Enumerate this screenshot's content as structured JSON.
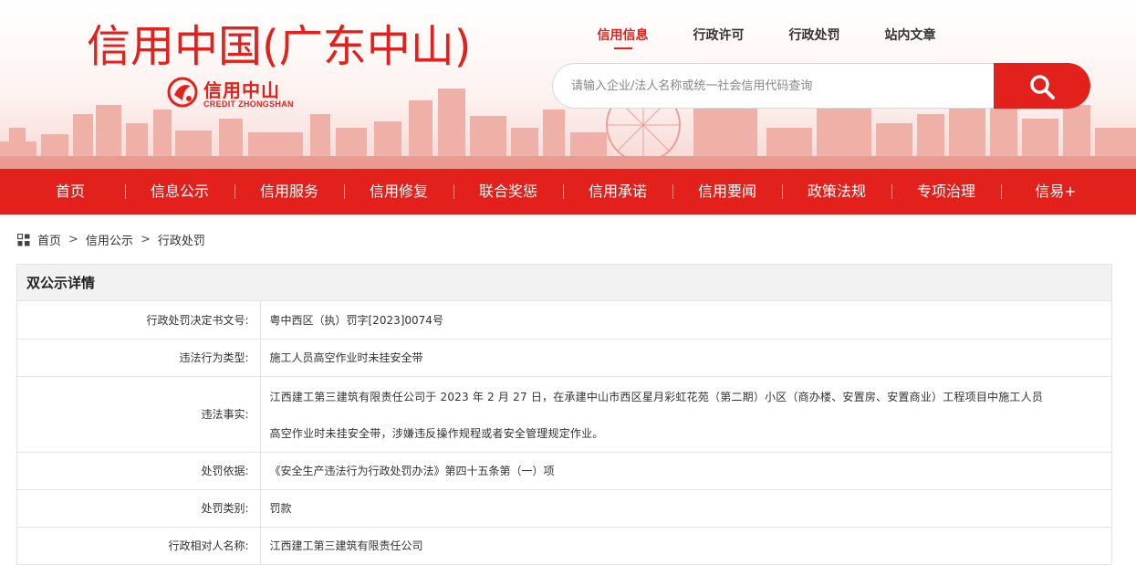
{
  "header": {
    "site_title": "信用中国(广东中山)",
    "logo_cn": "信用中山",
    "logo_en": "CREDIT ZHONGSHAN",
    "top_tabs": [
      {
        "label": "信用信息",
        "active": true
      },
      {
        "label": "行政许可",
        "active": false
      },
      {
        "label": "行政处罚",
        "active": false
      },
      {
        "label": "站内文章",
        "active": false
      }
    ],
    "search": {
      "placeholder": "请输入企业/法人名称或统一社会信用代码查询",
      "icon": "search-icon"
    },
    "colors": {
      "brand": "#e2211c"
    }
  },
  "nav": {
    "items": [
      "首页",
      "信息公示",
      "信用服务",
      "信用修复",
      "联合奖惩",
      "信用承诺",
      "信用要闻",
      "政策法规",
      "专项治理",
      "信易+"
    ]
  },
  "breadcrumb": {
    "icon": "grid-menu-icon",
    "items": [
      "首页",
      "信用公示",
      "行政处罚"
    ],
    "separator": ">"
  },
  "detail": {
    "title": "双公示详情",
    "rows": [
      {
        "label": "行政处罚决定书文号:",
        "value": "粤中西区（执）罚字[2023]0074号"
      },
      {
        "label": "违法行为类型:",
        "value": "施工人员高空作业时未挂安全带"
      },
      {
        "label": "违法事实:",
        "value_line1": "江西建工第三建筑有限责任公司于 2023 年 2 月 27 日，在承建中山市西区星月彩虹花苑（第二期）小区（商办楼、安置房、安置商业）工程项目中施工人员",
        "value_line2": "高空作业时未挂安全带，涉嫌违反操作规程或者安全管理规定作业。"
      },
      {
        "label": "处罚依据:",
        "value": "《安全生产违法行为行政处罚办法》第四十五条第（一）项"
      },
      {
        "label": "处罚类别:",
        "value": "罚款"
      },
      {
        "label": "行政相对人名称:",
        "value": "江西建工第三建筑有限责任公司"
      }
    ]
  }
}
